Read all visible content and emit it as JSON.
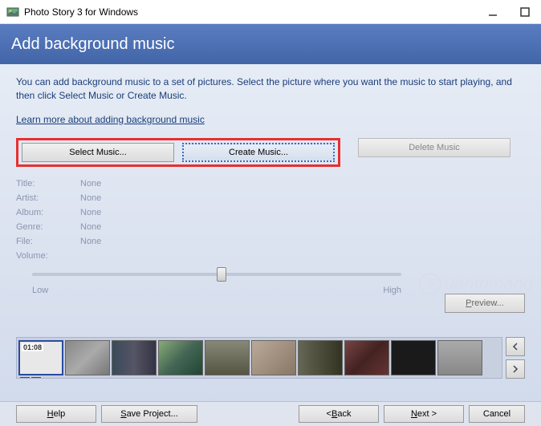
{
  "titlebar": {
    "title": "Photo Story 3 for Windows"
  },
  "header": {
    "title": "Add background music"
  },
  "description": "You can add background music to a set of pictures.  Select the picture where you want the music to start playing, and then click Select Music or Create Music.",
  "link": "Learn more about adding background music",
  "buttons": {
    "select": "Select Music...",
    "create": "Create Music...",
    "delete": "Delete Music",
    "preview": "Preview..."
  },
  "meta": {
    "labels": {
      "title": "Title:",
      "artist": "Artist:",
      "album": "Album:",
      "genre": "Genre:",
      "file": "File:",
      "volume": "Volume:"
    },
    "values": {
      "title": "None",
      "artist": "None",
      "album": "None",
      "genre": "None",
      "file": "None"
    }
  },
  "slider": {
    "low": "Low",
    "high": "High"
  },
  "watermark": "uantrimang",
  "filmstrip": {
    "selected_time": "01:08"
  },
  "bottom": {
    "help": "Help",
    "save": "Save Project...",
    "back": "< Back",
    "next": "Next >",
    "cancel": "Cancel"
  }
}
